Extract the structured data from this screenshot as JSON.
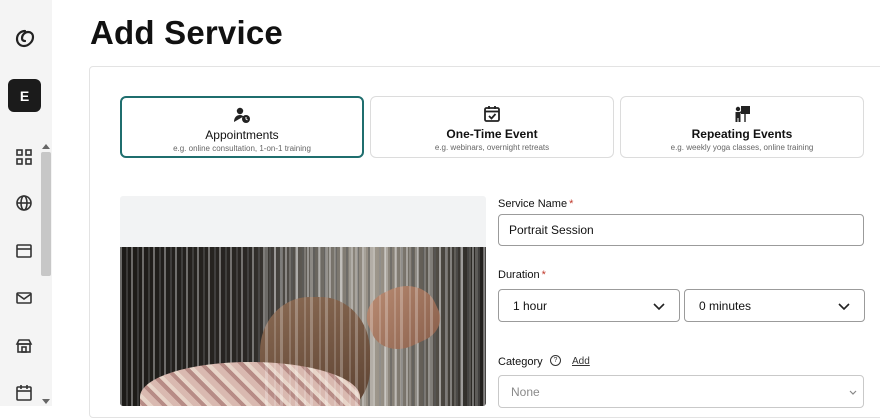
{
  "rail": {
    "avatar_letter": "E",
    "icons": [
      "logo-icon",
      "grid-icon",
      "globe-icon",
      "browser-icon",
      "mail-icon",
      "store-icon",
      "calendar-icon"
    ]
  },
  "header": {
    "title": "Add Service"
  },
  "service_types": [
    {
      "title": "Appointments",
      "subtitle": "e.g. online consultation, 1-on-1 training",
      "icon": "person-clock-icon",
      "selected": true
    },
    {
      "title": "One-Time Event",
      "subtitle": "e.g. webinars, overnight retreats",
      "icon": "calendar-check-icon",
      "selected": false
    },
    {
      "title": "Repeating Events",
      "subtitle": "e.g. weekly yoga classes, online training",
      "icon": "presenter-icon",
      "selected": false
    }
  ],
  "form": {
    "service_name_label": "Service Name",
    "required_mark": "*",
    "service_name_value": "Portrait Session",
    "duration_label": "Duration",
    "duration_hours": "1 hour",
    "duration_minutes": "0 minutes",
    "category_label": "Category",
    "category_help": "?",
    "category_add": "Add",
    "category_value": "None"
  },
  "colors": {
    "selected_border": "#1f6e6e",
    "required": "#c0392b",
    "rail_bg": "#f4f4f4"
  }
}
